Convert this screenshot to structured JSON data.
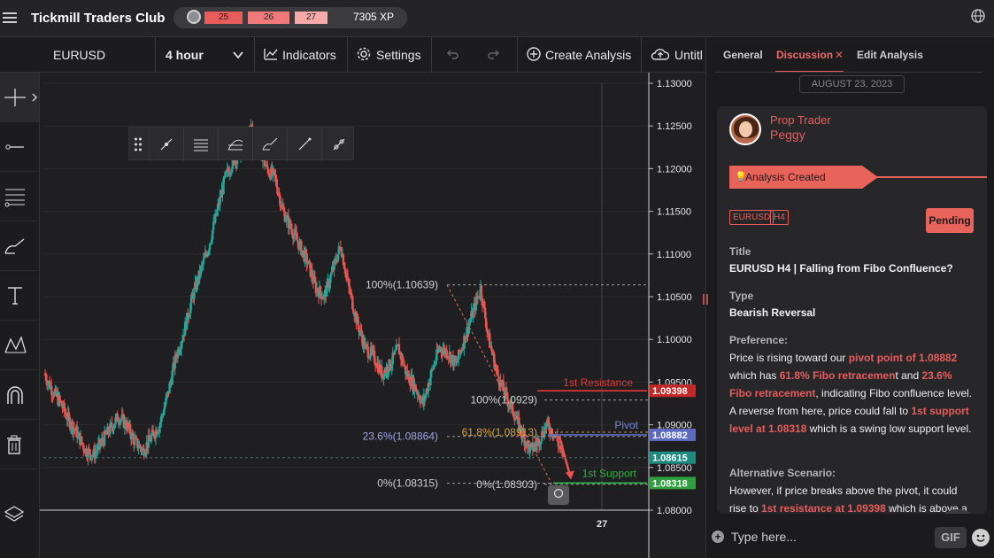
{
  "topbar": {
    "brand": "Tickmill Traders Club",
    "xp_levels": [
      "25",
      "26",
      "27"
    ],
    "xp_value": "7305 XP"
  },
  "toolbar": {
    "symbol": "EURUSD",
    "timeframe": "4 hour",
    "indicators": "Indicators",
    "settings": "Settings",
    "create_analysis": "Create Analysis",
    "untitled": "Untitl"
  },
  "chart": {
    "price_axis": [
      "1.13000",
      "1.12500",
      "1.12000",
      "1.11500",
      "1.11000",
      "1.10500",
      "1.10000",
      "1.09500",
      "1.09000",
      "1.08500",
      "1.08000"
    ],
    "time_label": "27",
    "fib_labels": {
      "f100": "100%(1.10639)",
      "f236": "23.6%(1.08864)",
      "f0": "0%(1.08315)",
      "g100": "100%(1.0929)",
      "g618": "61.8%(1.08913)",
      "g0": "0%(1.08303)"
    },
    "level_labels": {
      "resistance": "1st Resistance",
      "pivot": "Pivot",
      "support": "1st Support"
    },
    "price_tags": {
      "resistance": "1.09398",
      "pivot": "1.08882",
      "current": "1.08615",
      "support": "1.08318"
    },
    "colors": {
      "bull": "#26a69a",
      "bear": "#ef5350",
      "resistance": "#e53935",
      "pivot": "#5c6bc0",
      "support": "#2fb344",
      "fib": "#9e9e9e"
    }
  },
  "chart_data": {
    "type": "candlestick",
    "title": "",
    "symbol": "EURUSD",
    "timeframe": "4 hour",
    "ylim": [
      1.08,
      1.13
    ],
    "close_approx": [
      1.096,
      1.094,
      1.0925,
      1.0905,
      1.089,
      1.087,
      1.0865,
      1.088,
      1.0895,
      1.091,
      1.09,
      1.088,
      1.087,
      1.0885,
      1.09,
      1.0935,
      1.098,
      1.101,
      1.105,
      1.108,
      1.111,
      1.115,
      1.119,
      1.121,
      1.122,
      1.125,
      1.123,
      1.12,
      1.119,
      1.115,
      1.113,
      1.111,
      1.109,
      1.106,
      1.105,
      1.108,
      1.111,
      1.106,
      1.102,
      1.099,
      1.098,
      1.096,
      1.097,
      1.099,
      1.096,
      1.0945,
      1.0925,
      1.096,
      1.099,
      1.0985,
      1.097,
      1.1,
      1.103,
      1.106,
      1.1,
      1.096,
      1.0935,
      1.0915,
      1.089,
      1.087,
      1.088,
      1.09,
      1.089,
      1.0862
    ],
    "levels": {
      "1st Resistance": 1.09398,
      "Pivot": 1.08882,
      "1st Support": 1.08318
    }
  },
  "panel": {
    "tabs": [
      "General",
      "Discussion",
      "Edit Analysis"
    ],
    "date": "AUGUST 23, 2023",
    "role": "Prop Trader",
    "user": "Peggy",
    "status": "Analysis Created",
    "tags": [
      "EURUSD",
      "H4"
    ],
    "pending": "Pending",
    "title_label": "Title",
    "title_value": "EURUSD H4 | Falling from Fibo Confluence?",
    "type_label": "Type",
    "type_value": "Bearish Reversal",
    "pref_label": "Preference:",
    "pref_segments": [
      {
        "t": "Price is rising toward our ",
        "h": false
      },
      {
        "t": "pivot point of 1.08882",
        "h": true
      },
      {
        "t": " which has ",
        "h": false
      },
      {
        "t": "61.8% Fibo retracemen",
        "h": true
      },
      {
        "t": "t and ",
        "h": false
      },
      {
        "t": "23.6% Fibo retracement",
        "h": true
      },
      {
        "t": ", indicating Fibo confluence level. A reverse from here, price could fall to ",
        "h": false
      },
      {
        "t": "1st support level at 1.08318",
        "h": true
      },
      {
        "t": " which is a swing low support level.",
        "h": false
      }
    ],
    "alt_label": "Alternative Scenario:",
    "alt_segments": [
      {
        "t": "However, if price breaks above the pivot, it could rise to ",
        "h": false
      },
      {
        "t": "1st resistance at 1.09398",
        "h": true
      },
      {
        "t": " which is above a",
        "h": false
      }
    ],
    "composer_placeholder": "Type here...",
    "gif": "GIF"
  }
}
